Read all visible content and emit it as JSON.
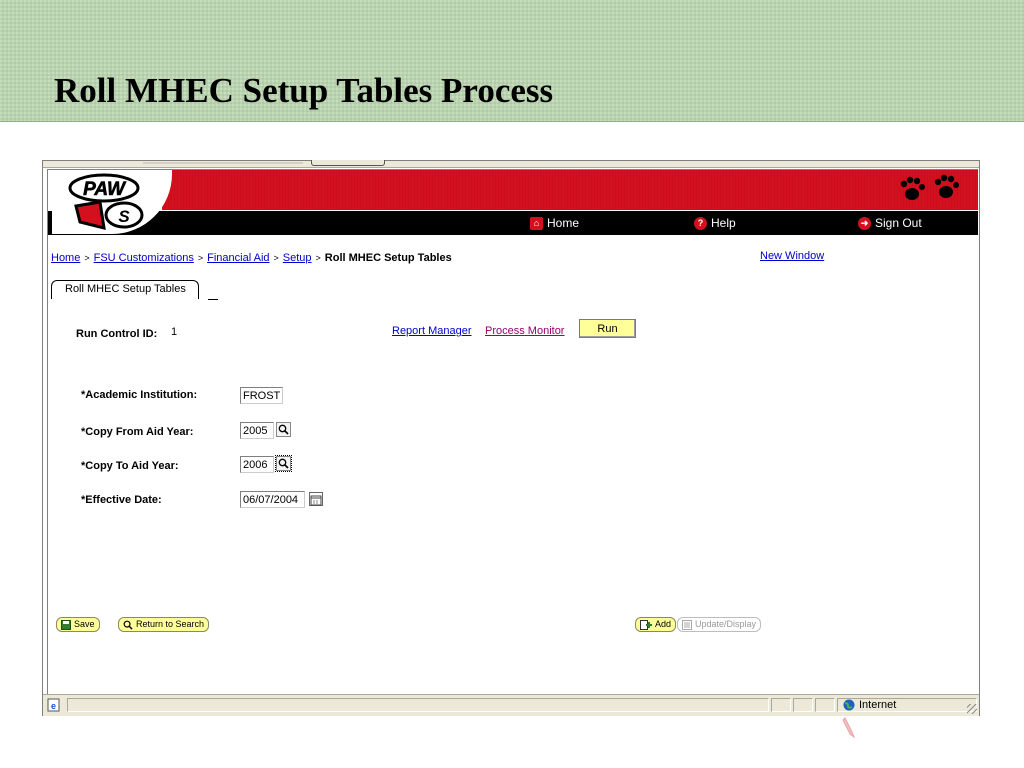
{
  "slide": {
    "title": "Roll MHEC Setup Tables Process"
  },
  "header": {
    "logo_text": "PAWS",
    "nav": {
      "home": "Home",
      "help": "Help",
      "sign_out": "Sign Out"
    }
  },
  "breadcrumb": {
    "items": [
      "Home",
      "FSU Customizations",
      "Financial Aid",
      "Setup"
    ],
    "current": "Roll MHEC Setup Tables",
    "separator": ">"
  },
  "new_window": "New Window",
  "tab": {
    "label": "Roll MHEC Setup Tables"
  },
  "run_control": {
    "label": "Run Control ID:",
    "value": "1",
    "report_manager": "Report Manager",
    "process_monitor": "Process Monitor",
    "run": "Run"
  },
  "form": {
    "academic_institution": {
      "label": "*Academic Institution:",
      "value": "FROST"
    },
    "copy_from_aid_year": {
      "label": "*Copy From Aid Year:",
      "value": "2005"
    },
    "copy_to_aid_year": {
      "label": "*Copy To Aid Year:",
      "value": "2006"
    },
    "effective_date": {
      "label": "*Effective Date:",
      "value": "06/07/2004"
    }
  },
  "buttons": {
    "save": "Save",
    "return_to_search": "Return to Search",
    "add": "Add",
    "update_display": "Update/Display"
  },
  "status_bar": {
    "zone": "Internet"
  },
  "colors": {
    "header_red": "#d4101f",
    "band_green": "#b9d3ae",
    "button_yellow": "#ffff99",
    "link_blue": "#0000cc",
    "link_purple": "#990066"
  }
}
